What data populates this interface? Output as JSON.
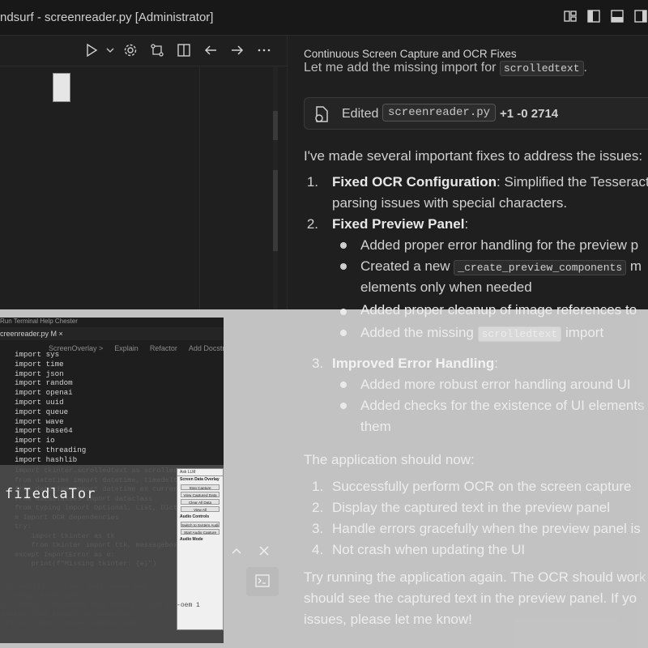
{
  "window": {
    "title": "ndsurf - screenreader.py [Administrator]"
  },
  "layout_icons": [
    "customize-layout-icon",
    "toggle-sidebar-icon",
    "toggle-panel-icon",
    "toggle-secondary-sidebar-icon"
  ],
  "editor_toolbar": {
    "icons": [
      "run-icon",
      "run-dropdown-icon",
      "settings-icon",
      "source-control-icon",
      "split-editor-icon",
      "back-icon",
      "forward-icon",
      "more-actions-icon"
    ]
  },
  "chat": {
    "header": "Continuous Screen Capture and OCR Fixes",
    "partial_prev": "Let me add the missing import for",
    "partial_prev_code": "scrolledtext",
    "edited": {
      "label": "Edited",
      "file": "screenreader.py",
      "stats": "+1 -0  2714"
    },
    "intro": "I've made several important fixes to address the issues:",
    "items": [
      {
        "num": "1.",
        "title": "Fixed OCR Configuration",
        "rest": ": Simplified the Tesseract",
        "cont": "parsing issues with special characters."
      },
      {
        "num": "2.",
        "title": "Fixed Preview Panel",
        "rest": ":"
      }
    ],
    "bullets": [
      {
        "text": "Added proper error handling for the preview p"
      },
      {
        "pre": "Created a new ",
        "code": "_create_preview_components",
        "post": " m",
        "cont": "elements only when needed"
      },
      {
        "text": "Added proper cleanup of image references to"
      },
      {
        "pre": "Added the missing ",
        "code": "scrolledtext",
        "post": " import"
      }
    ],
    "item3": {
      "num": "3.",
      "title": "Improved Error Handling",
      "rest": ":"
    },
    "bullets3": [
      {
        "text": "Added more robust error handling around UI"
      },
      {
        "text": "Added checks for the existence of UI elements",
        "cont": "them"
      }
    ],
    "should_now": "The application should now:",
    "now_list": [
      {
        "num": "1.",
        "text": "Successfully perform OCR on the screen capture"
      },
      {
        "num": "2.",
        "text": "Display the captured text in the preview panel"
      },
      {
        "num": "3.",
        "text": "Handle errors gracefully when the preview panel is"
      },
      {
        "num": "4.",
        "text": "Not crash when updating the UI"
      }
    ],
    "closing": [
      "Try running the application again. The OCR should work",
      "should see the captured text in the preview panel. If yo",
      "issues, please let me know!"
    ]
  },
  "inset": {
    "menubar": "Run   Terminal   Help                                        Chester",
    "tab": "creenreader.py M  ×",
    "codelens": [
      "ScreenOverlay >",
      "Explain",
      "Refactor",
      "Add Docstring"
    ],
    "code_lines": [
      "import sys",
      "import time",
      "import json",
      "import random",
      "import openai",
      "import uuid",
      "import queue",
      "import wave",
      "import base64",
      "import io",
      "import threading",
      "import hashlib"
    ],
    "lower_lines": [
      "import tkinter.scrolledtext as scrolledtext",
      "from datetime import datetime, timedelta",
      "from datetime import datetime as current_timestamp",
      "from dataclasses import dataclass",
      "from typing import Optional, List, Dict",
      "",
      "# Import OCR dependencies",
      "try:",
      "    import tkinter as tk",
      "    from tkinter import ttk, messagebox",
      "except ImportError as e:",
      "    print(f\"Missing tkinter: {e}\")"
    ],
    "big_label": "fiIedlaTor",
    "bottom_lines": [
      "sys.exit(1)     (256, 256), mode='RGB'",
      "# Configure OCR mode",
      "ocr_config = tesseract with config: --psm 6 --oem 1",
      "preview_text_length: 20 characters",
      "status: running screen capture loop..."
    ],
    "mini_app": {
      "title": "Ask LLM",
      "section": "Screen Data Overlay",
      "buttons": [
        "Stop Capture",
        "View Captured Data",
        "Clear All Data",
        "View All"
      ],
      "section2": "Audio Controls",
      "buttons2": [
        "Switch to System Audio",
        "Start Audio Capture"
      ],
      "section3": "Audio Mode"
    }
  }
}
